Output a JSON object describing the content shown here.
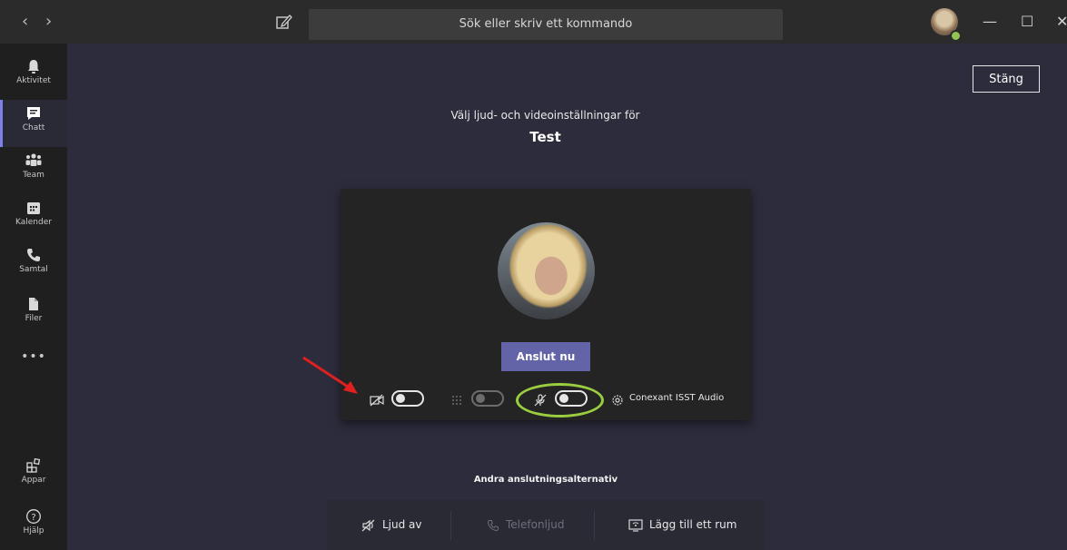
{
  "titlebar": {
    "back_arrow": "‹",
    "forward_arrow": "›",
    "search_placeholder": "Sök eller skriv ett kommando",
    "minimize": "—",
    "maximize": "☐",
    "close": "✕"
  },
  "rail": {
    "items": [
      {
        "label": "Aktivitet",
        "icon": "bell-icon"
      },
      {
        "label": "Chatt",
        "icon": "chat-icon",
        "active": true
      },
      {
        "label": "Team",
        "icon": "team-icon"
      },
      {
        "label": "Kalender",
        "icon": "calendar-icon"
      },
      {
        "label": "Samtal",
        "icon": "phone-icon"
      },
      {
        "label": "Filer",
        "icon": "file-icon"
      },
      {
        "label": "•••",
        "icon": "more-icon"
      },
      {
        "label": "Appar",
        "icon": "apps-icon"
      },
      {
        "label": "Hjälp",
        "icon": "help-icon"
      }
    ]
  },
  "main": {
    "close_label": "Stäng",
    "subtitle": "Välj ljud- och videoinställningar för",
    "meeting_title": "Test",
    "join_label": "Anslut nu",
    "device_label": "Conexant ISST Audio",
    "controls": {
      "camera_on": false,
      "blur_enabled": false,
      "mic_on": false
    },
    "other_options_title": "Andra anslutningsalternativ",
    "options": [
      {
        "label": "Ljud av",
        "icon": "speaker-off-icon"
      },
      {
        "label": "Telefonljud",
        "icon": "phone-icon",
        "disabled": true
      },
      {
        "label": "Lägg till ett rum",
        "icon": "room-icon"
      }
    ]
  },
  "colors": {
    "accent": "#6264a7",
    "annotation_arrow": "#e02020",
    "annotation_ring": "#9acd3f",
    "presence": "#92c353"
  }
}
